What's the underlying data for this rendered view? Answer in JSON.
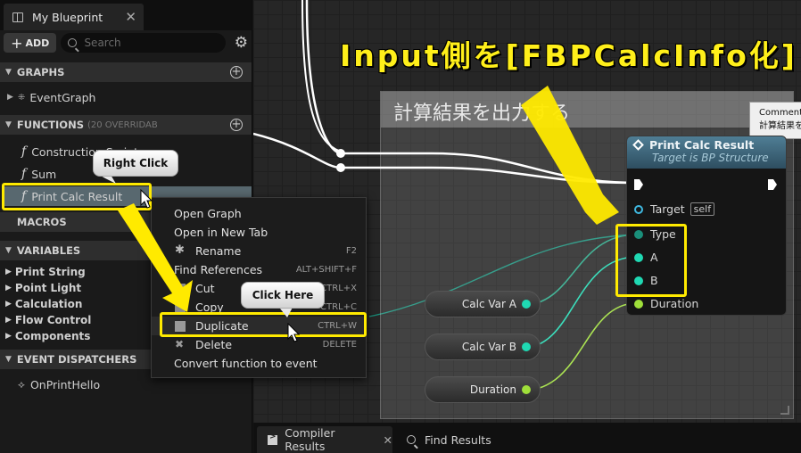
{
  "left_panel": {
    "tab_title": "My Blueprint",
    "tab_close": "✕",
    "add_label": "ADD",
    "search_placeholder": "Search",
    "sections": {
      "graphs": "GRAPHS",
      "functions": "FUNCTIONS",
      "functions_note": "(20 OVERRIDAB",
      "macros": "MACROS",
      "variables": "VARIABLES",
      "event_dispatchers": "EVENT DISPATCHERS"
    },
    "graph_items": [
      "EventGraph"
    ],
    "function_items": [
      "Construction Script",
      "Sum",
      "Print Calc Result"
    ],
    "variable_groups": [
      "Print String",
      "Point Light",
      "Calculation",
      "Flow Control",
      "Components"
    ],
    "dispatchers": [
      "OnPrintHello"
    ]
  },
  "context_menu": {
    "items": [
      {
        "label": "Open Graph",
        "shortcut": ""
      },
      {
        "label": "Open in New Tab",
        "shortcut": ""
      },
      {
        "label": "Rename",
        "shortcut": "F2"
      },
      {
        "label": "Find References",
        "shortcut": "ALT+SHIFT+F"
      },
      {
        "label": "Cut",
        "shortcut": "CTRL+X"
      },
      {
        "label": "Copy",
        "shortcut": "CTRL+C"
      },
      {
        "label": "Duplicate",
        "shortcut": "CTRL+W"
      },
      {
        "label": "Delete",
        "shortcut": "DELETE"
      },
      {
        "label": "Convert function to event",
        "shortcut": ""
      }
    ]
  },
  "callouts": {
    "right_click": "Right Click",
    "click_here": "Click Here"
  },
  "graph": {
    "headline": "Input側を[FBPCalcInfo化]",
    "comment_title": "計算結果を出力する",
    "comment_tip_line1": "Comment",
    "comment_tip_line2": "計算結果を",
    "node": {
      "title": "Print Calc Result",
      "subtitle": "Target is BP Structure",
      "pins": {
        "target": "Target",
        "self": "self",
        "type": "Type",
        "a": "A",
        "b": "B",
        "duration": "Duration"
      }
    },
    "variables": {
      "calc_var_a": "Calc Var A",
      "calc_var_b": "Calc Var B",
      "duration": "Duration"
    }
  },
  "bottom_tabs": {
    "compiler_results": "Compiler Results",
    "compiler_close": "✕",
    "find_results": "Find Results"
  },
  "colors": {
    "highlight": "#ffea00",
    "pin_teal": "#1fd9b3",
    "pin_lime": "#9fdf3a",
    "node_header": "#4f7e95",
    "selection": "#58686f"
  }
}
